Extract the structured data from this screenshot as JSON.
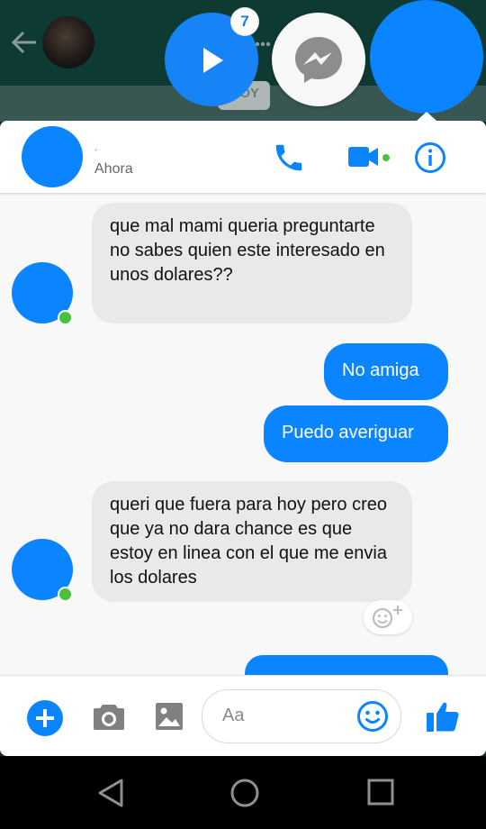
{
  "overlay": {
    "play_head": {
      "icon": "play-icon",
      "badge": "7"
    },
    "messenger_head": {
      "icon": "messenger-icon"
    },
    "contact_head": {
      "icon": "contact-avatar"
    },
    "background_app": {
      "chip_text": "OY"
    }
  },
  "header": {
    "contact_name": ".",
    "status": "Ahora",
    "icons": [
      "phone-icon",
      "video-camera-icon",
      "info-icon"
    ],
    "video_active_color": "#4ac23d"
  },
  "messages": [
    {
      "direction": "in",
      "text": "que mal mami queria preguntarte no sabes quien este interesado en unos dolares??"
    },
    {
      "direction": "out",
      "text": "No amiga"
    },
    {
      "direction": "out",
      "text": "Puedo averiguar"
    },
    {
      "direction": "in",
      "text": "queri que fuera para hoy pero creo que ya no dara chance es que estoy en linea con el que me envia los dolares"
    },
    {
      "direction": "out",
      "text": ""
    }
  ],
  "composer": {
    "placeholder": "Aa",
    "icons": [
      "plus-icon",
      "camera-icon",
      "gallery-icon",
      "emoji-icon",
      "like-icon"
    ]
  },
  "colors": {
    "accent": "#0a84ff",
    "bubble_in": "#e9e9e9",
    "online": "#4ac23d",
    "navbar": "#000000"
  },
  "navbar": {
    "buttons": [
      "back-icon",
      "home-icon",
      "recents-icon"
    ]
  }
}
